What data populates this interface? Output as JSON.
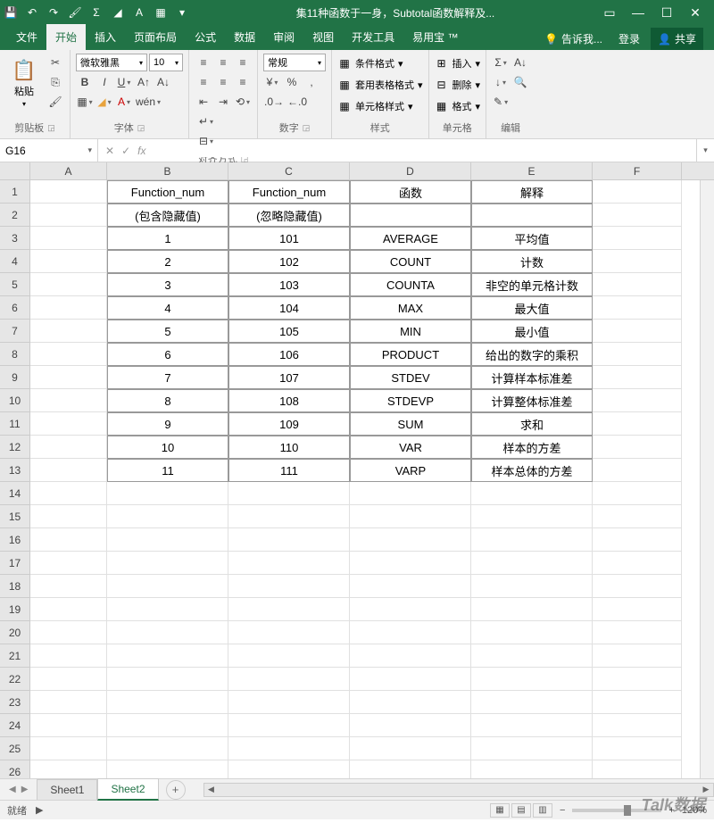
{
  "title": "集11种函数于一身，Subtotal函数解释及...",
  "tabs": [
    "文件",
    "开始",
    "插入",
    "页面布局",
    "公式",
    "数据",
    "审阅",
    "视图",
    "开发工具",
    "易用宝 ™"
  ],
  "active_tab": "开始",
  "tell_me": "告诉我...",
  "login": "登录",
  "share": "共享",
  "ribbon": {
    "clipboard": {
      "label": "剪贴板",
      "paste": "粘贴"
    },
    "font": {
      "label": "字体",
      "name": "微软雅黑",
      "size": "10"
    },
    "align": {
      "label": "对齐方式"
    },
    "number": {
      "label": "数字",
      "format": "常规"
    },
    "styles": {
      "label": "样式",
      "cond": "条件格式",
      "table": "套用表格格式",
      "cell": "单元格样式"
    },
    "cells": {
      "label": "单元格",
      "insert": "插入",
      "delete": "删除",
      "format": "格式"
    },
    "editing": {
      "label": "编辑"
    }
  },
  "name_box": "G16",
  "columns": [
    "A",
    "B",
    "C",
    "D",
    "E",
    "F"
  ],
  "col_widths": {
    "A": 86,
    "B": 136,
    "C": 136,
    "D": 136,
    "E": 136,
    "F": 100
  },
  "rows_visible": 26,
  "table": {
    "start_row": 1,
    "start_col": "B",
    "headers1": [
      "Function_num",
      "Function_num",
      "函数",
      "解释"
    ],
    "headers2": [
      "(包含隐藏值)",
      "(忽略隐藏值)",
      "",
      ""
    ],
    "data": [
      [
        "1",
        "101",
        "AVERAGE",
        "平均值"
      ],
      [
        "2",
        "102",
        "COUNT",
        "计数"
      ],
      [
        "3",
        "103",
        "COUNTA",
        "非空的单元格计数"
      ],
      [
        "4",
        "104",
        "MAX",
        "最大值"
      ],
      [
        "5",
        "105",
        "MIN",
        "最小值"
      ],
      [
        "6",
        "106",
        "PRODUCT",
        "给出的数字的乘积"
      ],
      [
        "7",
        "107",
        "STDEV",
        "计算样本标准差"
      ],
      [
        "8",
        "108",
        "STDEVP",
        "计算整体标准差"
      ],
      [
        "9",
        "109",
        "SUM",
        "求和"
      ],
      [
        "10",
        "110",
        "VAR",
        "样本的方差"
      ],
      [
        "11",
        "111",
        "VARP",
        "样本总体的方差"
      ]
    ]
  },
  "sheets": [
    "Sheet1",
    "Sheet2"
  ],
  "active_sheet": "Sheet2",
  "status": {
    "ready": "就绪",
    "zoom": "120%"
  },
  "watermark": "Talk数据"
}
